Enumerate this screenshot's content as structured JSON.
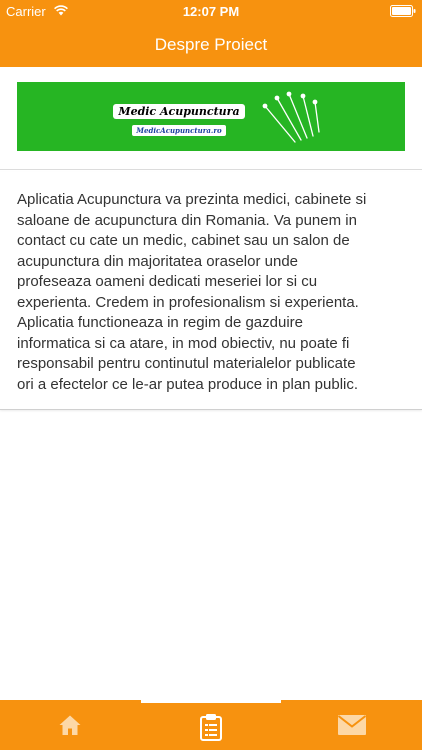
{
  "status_bar": {
    "carrier": "Carrier",
    "time": "12:07 PM"
  },
  "nav": {
    "title": "Despre Proiect"
  },
  "banner": {
    "title": "Medic Acupunctura",
    "url": "MedicAcupunctura.ro"
  },
  "about": {
    "text": "Aplicatia Acupunctura va prezinta medici, cabinete si\nsaloane de acupunctura din Romania. Va punem in\ncontact cu cate un medic, cabinet sau un salon de\nacupunctura din majoritatea oraselor unde\nprofeseaza oameni dedicati meseriei lor si cu\nexperienta.  Credem in profesionalism si experienta.\nAplicatia functioneaza in regim de gazduire\ninformatica si ca atare, in mod obiectiv, nu poate fi\nresponsabil pentru continutul materialelor publicate\nori a efectelor ce le-ar putea produce in plan public."
  },
  "tabs": [
    {
      "icon": "home-icon",
      "selected": false
    },
    {
      "icon": "clipboard-icon",
      "selected": true
    },
    {
      "icon": "mail-icon",
      "selected": false
    }
  ],
  "colors": {
    "accent": "#f7920f",
    "banner_green": "#26b523",
    "url_blue": "#1a3fa0"
  }
}
